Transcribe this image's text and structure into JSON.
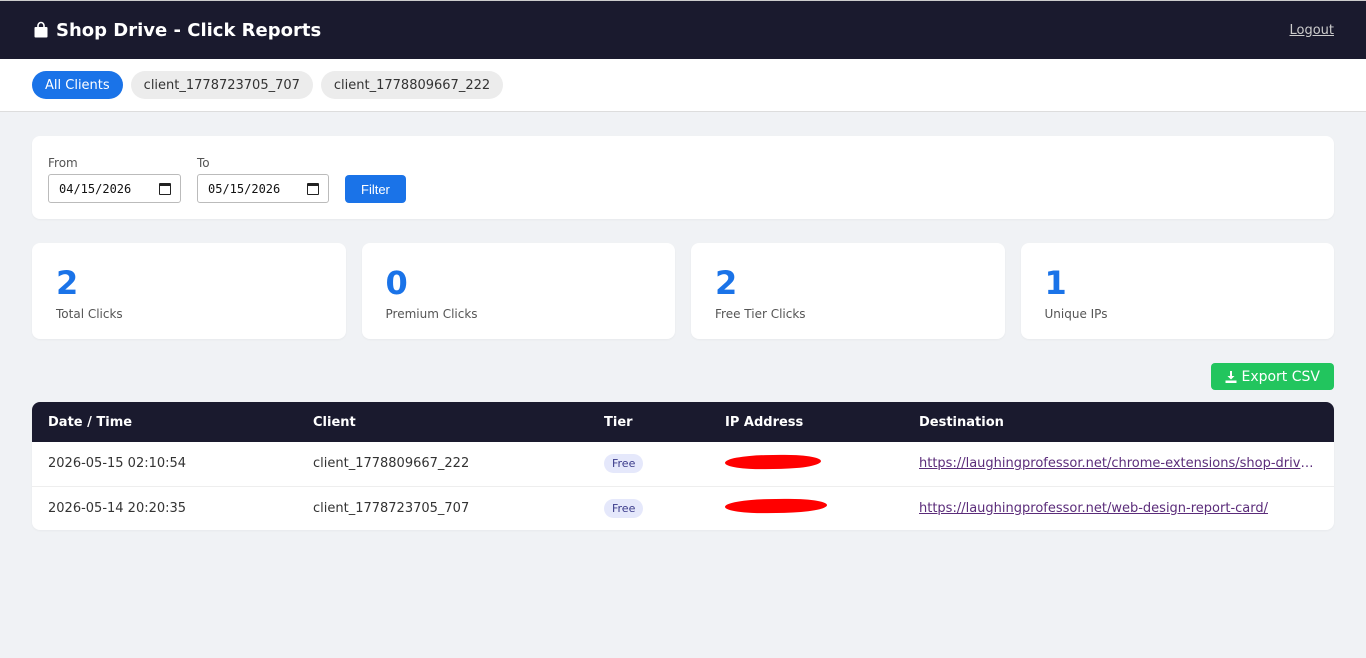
{
  "header": {
    "title": "Shop Drive - Click Reports",
    "brand_icon": "shopping-bag-icon",
    "logout_label": "Logout"
  },
  "clients": {
    "items": [
      {
        "label": "All Clients",
        "active": true
      },
      {
        "label": "client_1778723705_707",
        "active": false
      },
      {
        "label": "client_1778809667_222",
        "active": false
      }
    ]
  },
  "filter": {
    "from_label": "From",
    "from_value": "04/15/2026",
    "to_label": "To",
    "to_value": "05/15/2026",
    "button_label": "Filter"
  },
  "stats": [
    {
      "value": "2",
      "label": "Total Clicks"
    },
    {
      "value": "0",
      "label": "Premium Clicks"
    },
    {
      "value": "2",
      "label": "Free Tier Clicks"
    },
    {
      "value": "1",
      "label": "Unique IPs"
    }
  ],
  "export": {
    "label": "Export CSV",
    "icon": "download-icon"
  },
  "table": {
    "headers": [
      "Date / Time",
      "Client",
      "Tier",
      "IP Address",
      "Destination"
    ],
    "rows": [
      {
        "datetime": "2026-05-15 02:10:54",
        "client": "client_1778809667_222",
        "tier": "Free",
        "destination": "https://laughingprofessor.net/chrome-extensions/shop-drive-c..."
      },
      {
        "datetime": "2026-05-14 20:20:35",
        "client": "client_1778723705_707",
        "tier": "Free",
        "destination": "https://laughingprofessor.net/web-design-report-card/"
      }
    ]
  },
  "colors": {
    "header_bg": "#1a1a2e",
    "accent": "#1a73e8",
    "export_green": "#22c55e",
    "redaction": "#ff0000"
  }
}
